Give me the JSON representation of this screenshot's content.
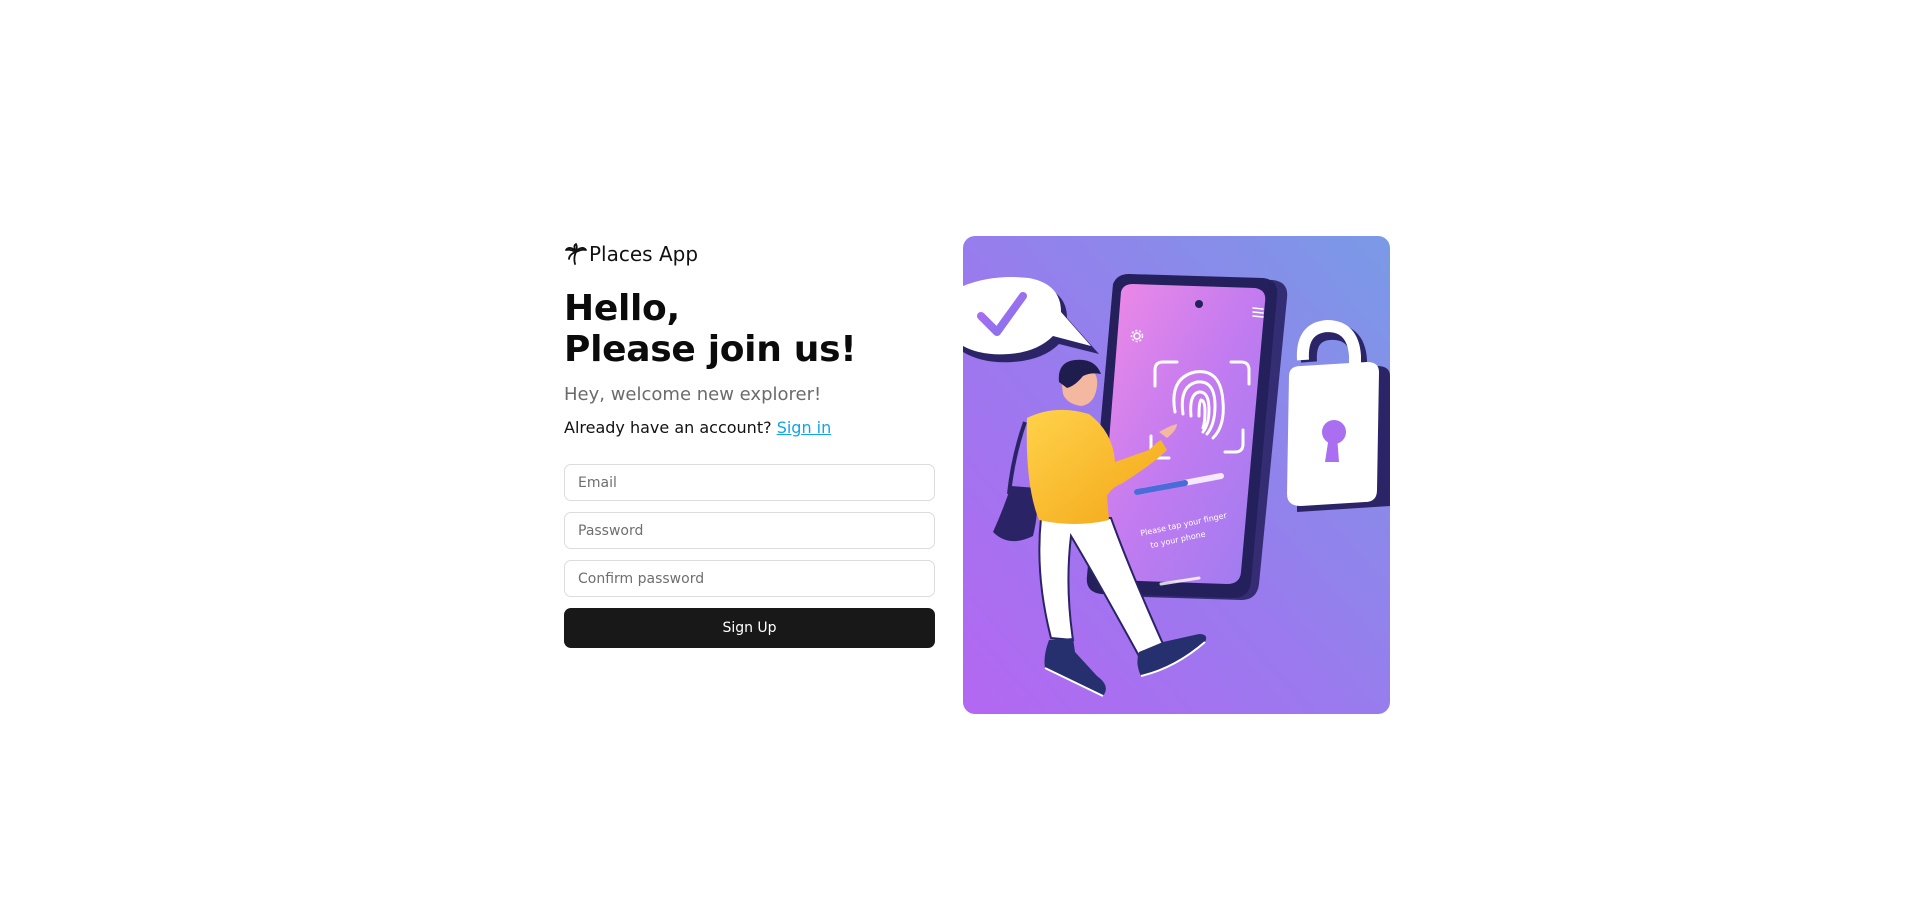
{
  "brand": {
    "name": "Places App",
    "icon": "palm-tree-icon"
  },
  "heading": {
    "line1": "Hello,",
    "line2": "Please join us!"
  },
  "subtitle": "Hey, welcome new explorer!",
  "signin": {
    "prompt": "Already have an account?",
    "link_label": "Sign in"
  },
  "form": {
    "email_placeholder": "Email",
    "password_placeholder": "Password",
    "confirm_placeholder": "Confirm password",
    "submit_label": "Sign Up"
  },
  "illustration": {
    "phone_caption_line1": "Please tap your finger",
    "phone_caption_line2": "to your phone",
    "icons": [
      "checkmark-bubble-icon",
      "fingerprint-icon",
      "padlock-icon",
      "menu-icon",
      "settings-icon"
    ]
  },
  "colors": {
    "accent_link": "#0ea5e9",
    "button_bg": "#181818",
    "illustration_bg_top": "#7e93e6",
    "illustration_bg_bottom": "#b06cf0"
  }
}
